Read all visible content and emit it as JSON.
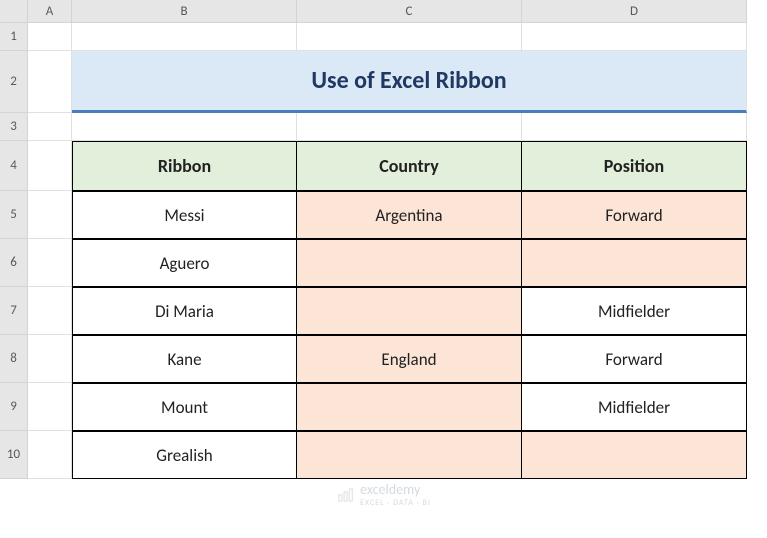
{
  "columns": {
    "corner": "",
    "A": "A",
    "B": "B",
    "C": "C",
    "D": "D"
  },
  "rows": {
    "r1": "1",
    "r2": "2",
    "r3": "3",
    "r4": "4",
    "r5": "5",
    "r6": "6",
    "r7": "7",
    "r8": "8",
    "r9": "9",
    "r10": "10"
  },
  "title": "Use of Excel Ribbon",
  "headers": {
    "col1": "Ribbon",
    "col2": "Country",
    "col3": "Position"
  },
  "table": [
    {
      "ribbon": "Messi",
      "country": "Argentina",
      "position": "Forward"
    },
    {
      "ribbon": "Aguero",
      "country": "",
      "position": ""
    },
    {
      "ribbon": "Di Maria",
      "country": "",
      "position": "Midfielder"
    },
    {
      "ribbon": "Kane",
      "country": "England",
      "position": "Forward"
    },
    {
      "ribbon": "Mount",
      "country": "",
      "position": "Midfielder"
    },
    {
      "ribbon": "Grealish",
      "country": "",
      "position": ""
    }
  ],
  "watermark": {
    "brand": "exceldemy",
    "tag": "EXCEL · DATA · BI"
  }
}
